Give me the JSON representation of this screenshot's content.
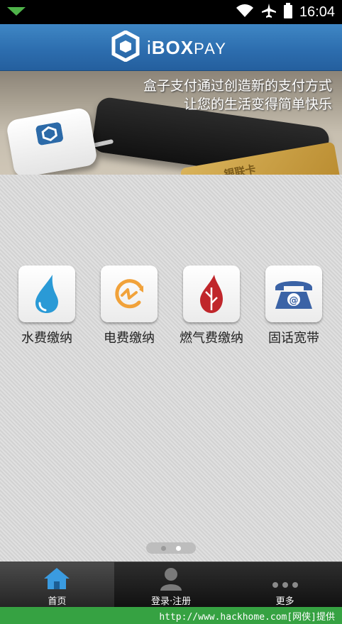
{
  "status_bar": {
    "time": "16:04"
  },
  "header": {
    "logo_prefix": "i",
    "logo_bold": "BOX",
    "logo_light": "PAY"
  },
  "banner": {
    "slogan_line1": "盒子支付通过创造新的支付方式",
    "slogan_line2": "让您的生活变得简单快乐",
    "card_text": "银联卡"
  },
  "services": [
    {
      "label": "水费缴纳",
      "icon": "water-drop-icon",
      "color": "#2a9ad6"
    },
    {
      "label": "电费缴纳",
      "icon": "electricity-icon",
      "color": "#f1a23a"
    },
    {
      "label": "燃气费缴纳",
      "icon": "gas-flame-icon",
      "color": "#c0262b"
    },
    {
      "label": "固话宽带",
      "icon": "telephone-icon",
      "color": "#3b63a6"
    }
  ],
  "pager": {
    "count": 2,
    "active_index": 1
  },
  "tabbar": {
    "tabs": [
      {
        "label": "首页",
        "icon": "home-icon",
        "active": true
      },
      {
        "label": "登录·注册",
        "icon": "user-icon",
        "active": false
      },
      {
        "label": "更多",
        "icon": "more-icon",
        "active": false
      }
    ]
  },
  "footer": {
    "text": "http://www.hackhome.com[网侠]提供"
  },
  "colors": {
    "header_blue": "#2d6eaf",
    "footer_green": "#36a242"
  }
}
